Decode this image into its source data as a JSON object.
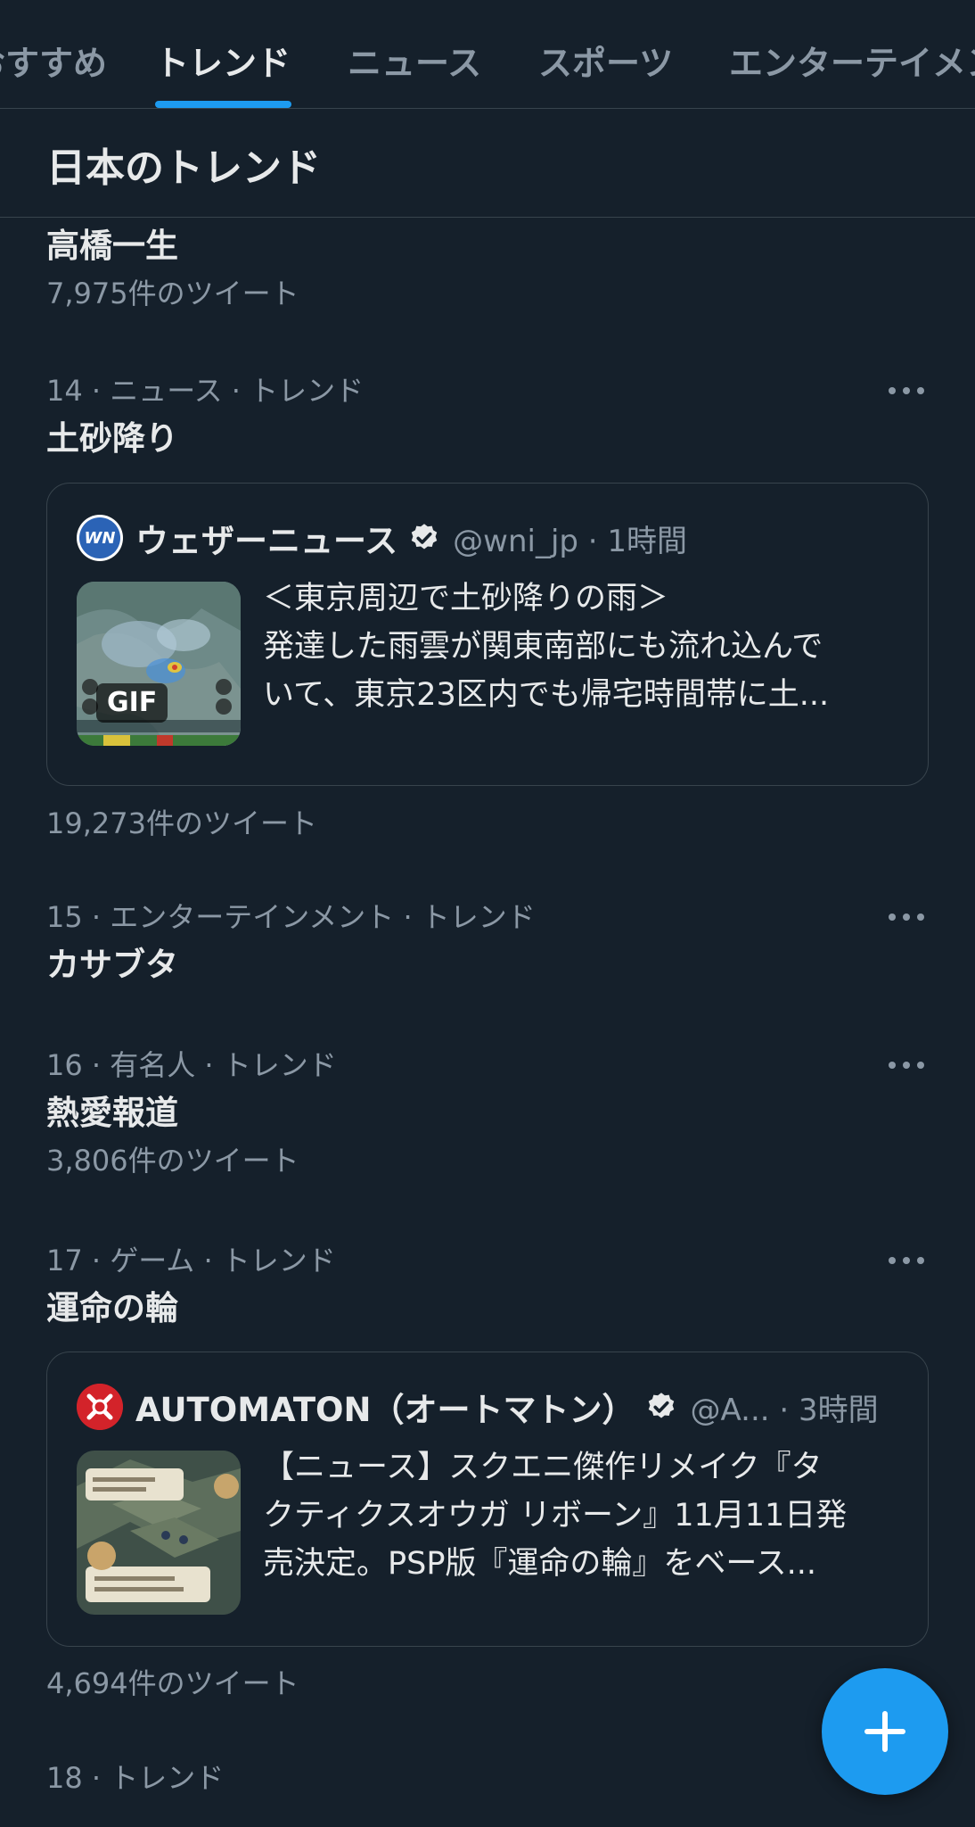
{
  "tabs": [
    {
      "label": "おすすめ"
    },
    {
      "label": "トレンド"
    },
    {
      "label": "ニュース"
    },
    {
      "label": "スポーツ"
    },
    {
      "label": "エンターテイメント"
    }
  ],
  "active_tab": "トレンド",
  "section_title": "日本のトレンド",
  "trends": [
    {
      "meta": "",
      "name": "高橋一生",
      "count": "7,975件のツイート"
    },
    {
      "meta": "14 · ニュース · トレンド",
      "name": "土砂降り",
      "count": "19,273件のツイート",
      "card": {
        "author": "ウェザーニュース",
        "handle": "@wni_jp · 1時間",
        "avatar_text": "WN",
        "thumb_badge": "GIF",
        "lines": [
          "＜東京周辺で土砂降りの雨＞",
          "発達した雨雲が関東南部にも流れ込んで",
          "いて、東京23区内でも帰宅時間帯に土..."
        ]
      }
    },
    {
      "meta": "15 · エンターテインメント · トレンド",
      "name": "カサブタ",
      "count": ""
    },
    {
      "meta": "16 · 有名人 · トレンド",
      "name": "熱愛報道",
      "count": "3,806件のツイート"
    },
    {
      "meta": "17 · ゲーム · トレンド",
      "name": "運命の輪",
      "count": "4,694件のツイート",
      "card": {
        "author": "AUTOMATON（オートマトン）",
        "handle": "@A... · 3時間",
        "lines": [
          "【ニュース】スクエニ傑作リメイク『タ",
          "クティクスオウガ リボーン』11月11日発",
          "売決定。PSP版『運命の輪』をベース..."
        ]
      }
    },
    {
      "meta": "18 · トレンド",
      "name": "",
      "count": ""
    }
  ],
  "colors": {
    "background": "#15202b",
    "accent": "#1d9bf0",
    "text_primary": "#e7e9ea",
    "text_secondary": "#8b98a5",
    "border": "#38444d"
  },
  "icons": {
    "more": "more-horizontal-icon",
    "verified": "verified-badge-icon",
    "fab": "plus-icon"
  }
}
